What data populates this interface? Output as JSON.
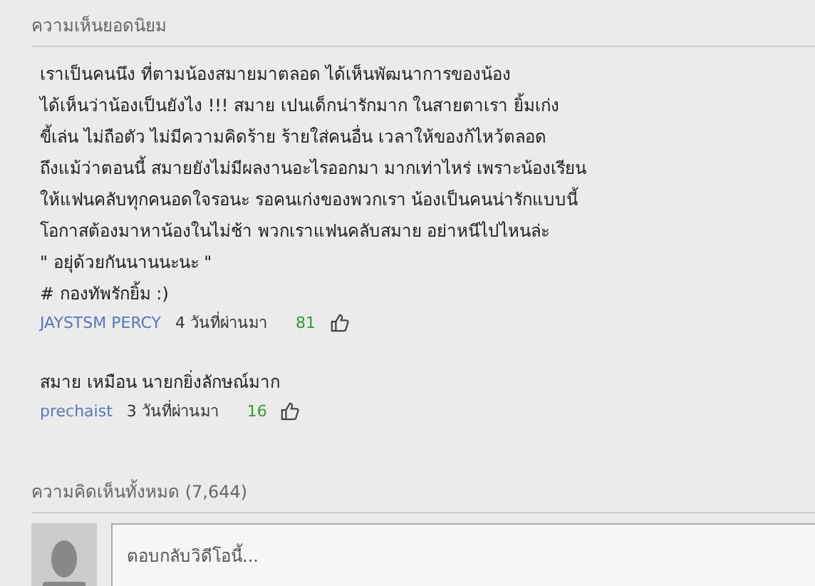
{
  "top_comments": {
    "heading": "ความเห็นยอดนิยม",
    "comments": [
      {
        "lines": [
          "เราเป็นคนนึง ที่ตามน้องสมายมาตลอด ได้เห็นพัฒนาการของน้อง",
          "ได้เห็นว่าน้องเป็นยังไง !!! สมาย เปนเด็กน่ารักมาก ในสายตาเรา ยิ้มเก่ง",
          "ขี้เล่น ไม่ถือตัว ไม่มีความคิดร้าย ร้ายใส่คนอื่น เวลาให้ของก้ไหว้ตลอด",
          "ถึงแม้ว่าตอนนี้ สมายยังไม่มีผลงานอะไรออกมา มากเท่าไหร่ เพราะน้องเรียน",
          "ให้แฟนคลับทุกคนอดใจรอนะ รอคนเก่งของพวกเรา น้องเป็นคนน่ารักแบบนี้",
          "โอกาสต้องมาหาน้องในไม่ช้า พวกเราแฟนคลับสมาย อย่าหนีไปไหนล่ะ",
          "\" อยุ่ด้วยกันนานนะนะ \"",
          "# กองทัพรักยิ้ม :)"
        ],
        "author": "JAYSTSM PERCY",
        "time": "4 วันที่ผ่านมา",
        "likes": "81"
      },
      {
        "lines": [
          "สมาย เหมือน นายกยิ่งลักษณ์มาก"
        ],
        "author": "prechaist",
        "time": "3 วันที่ผ่านมา",
        "likes": "16"
      }
    ]
  },
  "all_comments": {
    "heading": "ความคิดเห็นทั้งหมด (7,644)",
    "reply_placeholder": "ตอบกลับวิดีโอนี้..."
  }
}
